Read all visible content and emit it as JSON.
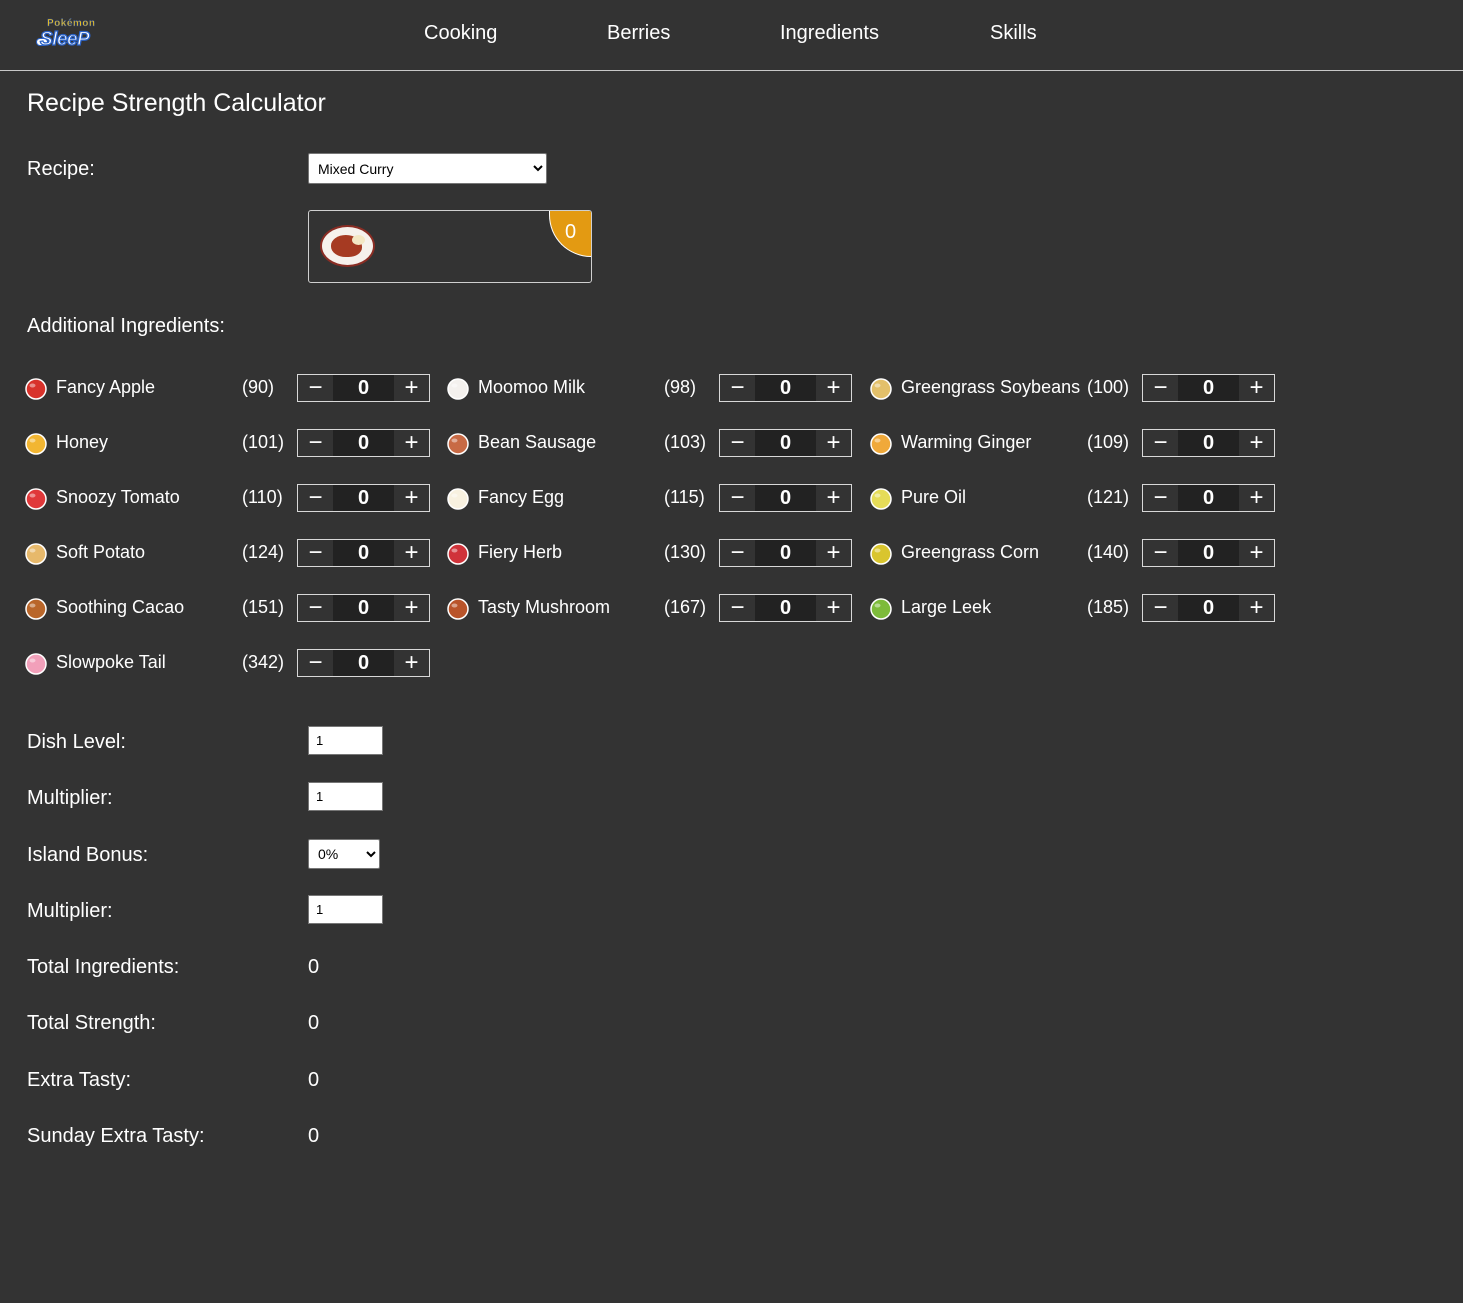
{
  "header": {
    "logo_top": "Pokémon",
    "logo_main": "SleeP",
    "nav": [
      "Cooking",
      "Berries",
      "Ingredients",
      "Skills"
    ]
  },
  "title": "Recipe Strength Calculator",
  "recipe": {
    "label": "Recipe:",
    "selected": "Mixed Curry",
    "badge": "0"
  },
  "additional_label": "Additional Ingredients:",
  "ingredients": [
    {
      "name": "Fancy Apple",
      "strength": "(90)",
      "count": "0",
      "icon": "apple-icon",
      "color": "#d8322b"
    },
    {
      "name": "Moomoo Milk",
      "strength": "(98)",
      "count": "0",
      "icon": "milk-bottle-icon",
      "color": "#f4f1ee"
    },
    {
      "name": "Greengrass Soybeans",
      "strength": "(100)",
      "count": "0",
      "icon": "soybeans-icon",
      "color": "#e3c06a"
    },
    {
      "name": "Honey",
      "strength": "(101)",
      "count": "0",
      "icon": "honey-jar-icon",
      "color": "#f2b632"
    },
    {
      "name": "Bean Sausage",
      "strength": "(103)",
      "count": "0",
      "icon": "sausage-icon",
      "color": "#c86a45"
    },
    {
      "name": "Warming Ginger",
      "strength": "(109)",
      "count": "0",
      "icon": "ginger-icon",
      "color": "#f0a93a"
    },
    {
      "name": "Snoozy Tomato",
      "strength": "(110)",
      "count": "0",
      "icon": "tomato-icon",
      "color": "#e0383a"
    },
    {
      "name": "Fancy Egg",
      "strength": "(115)",
      "count": "0",
      "icon": "egg-icon",
      "color": "#f8f1e0"
    },
    {
      "name": "Pure Oil",
      "strength": "(121)",
      "count": "0",
      "icon": "oil-bottle-icon",
      "color": "#e6dc58"
    },
    {
      "name": "Soft Potato",
      "strength": "(124)",
      "count": "0",
      "icon": "potato-icon",
      "color": "#e7b96b"
    },
    {
      "name": "Fiery Herb",
      "strength": "(130)",
      "count": "0",
      "icon": "herb-icon",
      "color": "#d0333a"
    },
    {
      "name": "Greengrass Corn",
      "strength": "(140)",
      "count": "0",
      "icon": "corn-icon",
      "color": "#d9c52e"
    },
    {
      "name": "Soothing Cacao",
      "strength": "(151)",
      "count": "0",
      "icon": "cacao-icon",
      "color": "#b9662a"
    },
    {
      "name": "Tasty Mushroom",
      "strength": "(167)",
      "count": "0",
      "icon": "mushroom-icon",
      "color": "#b9542a"
    },
    {
      "name": "Large Leek",
      "strength": "(185)",
      "count": "0",
      "icon": "leek-icon",
      "color": "#7dbb3a"
    },
    {
      "name": "Slowpoke Tail",
      "strength": "(342)",
      "count": "0",
      "icon": "slowpoke-tail-icon",
      "color": "#f2a0ba"
    }
  ],
  "stepper": {
    "minus": "−",
    "plus": "+"
  },
  "fields": {
    "dish_level_label": "Dish Level:",
    "dish_level_value": "1",
    "multiplier1_label": "Multiplier:",
    "multiplier1_value": "1",
    "island_bonus_label": "Island Bonus:",
    "island_bonus_value": "0%",
    "multiplier2_label": "Multiplier:",
    "multiplier2_value": "1"
  },
  "results": {
    "total_ingredients_label": "Total Ingredients:",
    "total_ingredients": "0",
    "total_strength_label": "Total Strength:",
    "total_strength": "0",
    "extra_tasty_label": "Extra Tasty:",
    "extra_tasty": "0",
    "sunday_extra_tasty_label": "Sunday Extra Tasty:",
    "sunday_extra_tasty": "0"
  },
  "colors": {
    "background": "#333333",
    "badge": "#e39a12"
  }
}
